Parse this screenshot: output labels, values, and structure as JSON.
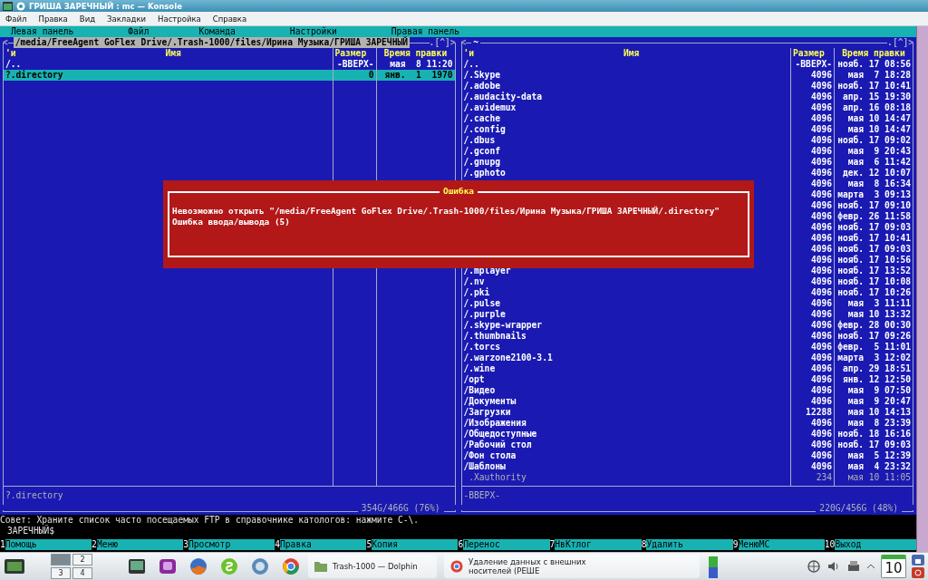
{
  "window": {
    "title": "ГРИША ЗАРЕЧНЫЙ : mc — Konsole"
  },
  "menu_bar": [
    "Файл",
    "Правка",
    "Вид",
    "Закладки",
    "Настройка",
    "Справка"
  ],
  "mc_menu": [
    "Левая панель",
    "Файл",
    "Команда",
    "Настройки",
    "Правая панель"
  ],
  "left_panel": {
    "active": true,
    "corner_left": "<",
    "path": "/media/FreeAgent GoFlex Drive/.Trash-1000/files/Ирина Музыка/ГРИША ЗАРЕЧНЫЙ",
    "corner_right": ".[^]>",
    "sort_mark": "'и",
    "columns": [
      "Имя",
      "Размер",
      "Время правки"
    ],
    "rows": [
      {
        "name": "/..",
        "size": "-ВВЕРХ-",
        "time": "мая  8 11:20",
        "kind": "dir",
        "selected": false
      },
      {
        "name": "?.directory",
        "size": "0",
        "time": "янв.  1  1970",
        "kind": "dir",
        "selected": true
      }
    ],
    "status": "?.directory",
    "disk": "354G/466G (76%)"
  },
  "right_panel": {
    "active": false,
    "corner_left": "<",
    "path": "~",
    "corner_right": ".[^]>",
    "sort_mark": "'и",
    "columns": [
      "Имя",
      "Размер",
      "Время правки"
    ],
    "rows": [
      {
        "name": "/..",
        "size": "-ВВЕРХ-",
        "time": "нояб. 17 08:56",
        "kind": "dir",
        "selected": false
      },
      {
        "name": "/.Skype",
        "size": "4096",
        "time": "мая  7 18:28",
        "kind": "dir",
        "selected": false
      },
      {
        "name": "/.adobe",
        "size": "4096",
        "time": "нояб. 17 10:41",
        "kind": "dir",
        "selected": false
      },
      {
        "name": "/.audacity-data",
        "size": "4096",
        "time": "апр. 15 19:30",
        "kind": "dir",
        "selected": false
      },
      {
        "name": "/.avidemux",
        "size": "4096",
        "time": "апр. 16 08:18",
        "kind": "dir",
        "selected": false
      },
      {
        "name": "/.cache",
        "size": "4096",
        "time": "мая 10 14:47",
        "kind": "dir",
        "selected": false
      },
      {
        "name": "/.config",
        "size": "4096",
        "time": "мая 10 14:47",
        "kind": "dir",
        "selected": false
      },
      {
        "name": "/.dbus",
        "size": "4096",
        "time": "нояб. 17 09:02",
        "kind": "dir",
        "selected": false
      },
      {
        "name": "/.gconf",
        "size": "4096",
        "time": "мая  9 20:43",
        "kind": "dir",
        "selected": false
      },
      {
        "name": "/.gnupg",
        "size": "4096",
        "time": "мая  6 11:42",
        "kind": "dir",
        "selected": false
      },
      {
        "name": "/.gphoto",
        "size": "4096",
        "time": "дек. 12 10:07",
        "kind": "dir",
        "selected": false
      },
      {
        "size": "4096",
        "time": "мая  8 16:34",
        "kind": "dir",
        "selected": false
      },
      {
        "size": "4096",
        "time": "марта  3 09:13",
        "kind": "dir",
        "selected": false
      },
      {
        "size": "4096",
        "time": "нояб. 17 09:10",
        "kind": "dir",
        "selected": false
      },
      {
        "size": "4096",
        "time": "февр. 26 11:58",
        "kind": "dir",
        "selected": false
      },
      {
        "size": "4096",
        "time": "нояб. 17 09:03",
        "kind": "dir",
        "selected": false
      },
      {
        "size": "4096",
        "time": "нояб. 17 10:41",
        "kind": "dir",
        "selected": false
      },
      {
        "size": "4096",
        "time": "нояб. 17 09:03",
        "kind": "dir",
        "selected": false
      },
      {
        "size": "4096",
        "time": "нояб. 17 10:56",
        "kind": "dir",
        "selected": false
      },
      {
        "name": "/.mplayer",
        "size": "4096",
        "time": "нояб. 17 13:52",
        "kind": "dir",
        "selected": false
      },
      {
        "name": "/.nv",
        "size": "4096",
        "time": "нояб. 17 10:08",
        "kind": "dir",
        "selected": false
      },
      {
        "name": "/.pki",
        "size": "4096",
        "time": "нояб. 17 10:26",
        "kind": "dir",
        "selected": false
      },
      {
        "name": "/.pulse",
        "size": "4096",
        "time": "мая  3 11:11",
        "kind": "dir",
        "selected": false
      },
      {
        "name": "/.purple",
        "size": "4096",
        "time": "мая 10 13:32",
        "kind": "dir",
        "selected": false
      },
      {
        "name": "/.skype-wrapper",
        "size": "4096",
        "time": "февр. 28 00:30",
        "kind": "dir",
        "selected": false
      },
      {
        "name": "/.thumbnails",
        "size": "4096",
        "time": "нояб. 17 09:26",
        "kind": "dir",
        "selected": false
      },
      {
        "name": "/.torcs",
        "size": "4096",
        "time": "февр.  5 11:01",
        "kind": "dir",
        "selected": false
      },
      {
        "name": "/.warzone2100-3.1",
        "size": "4096",
        "time": "марта  3 12:02",
        "kind": "dir",
        "selected": false
      },
      {
        "name": "/.wine",
        "size": "4096",
        "time": "апр. 29 18:51",
        "kind": "dir",
        "selected": false
      },
      {
        "name": "/opt",
        "size": "4096",
        "time": "янв. 12 12:50",
        "kind": "dir",
        "selected": false
      },
      {
        "name": "/Видео",
        "size": "4096",
        "time": "мая  9 07:50",
        "kind": "dir",
        "selected": false
      },
      {
        "name": "/Документы",
        "size": "4096",
        "time": "мая  9 20:47",
        "kind": "dir",
        "selected": false
      },
      {
        "name": "/Загрузки",
        "size": "12288",
        "time": "мая 10 14:13",
        "kind": "dir",
        "selected": false
      },
      {
        "name": "/Изображения",
        "size": "4096",
        "time": "мая  8 23:39",
        "kind": "dir",
        "selected": false
      },
      {
        "name": "/Общедоступные",
        "size": "4096",
        "time": "нояб. 18 16:16",
        "kind": "dir",
        "selected": false
      },
      {
        "name": "/Рабочий стол",
        "size": "4096",
        "time": "нояб. 17 09:03",
        "kind": "dir",
        "selected": false
      },
      {
        "name": "/Фон стола",
        "size": "4096",
        "time": "мая  5 12:39",
        "kind": "dir",
        "selected": false
      },
      {
        "name": "/Шаблоны",
        "size": "4096",
        "time": "мая  4 23:32",
        "kind": "dir",
        "selected": false
      },
      {
        "name": ".Xauthority",
        "size": "234",
        "time": "мая 10 11:05",
        "kind": "file",
        "selected": false
      }
    ],
    "status": "-ВВЕРХ-",
    "disk": "220G/456G (48%)"
  },
  "dialog": {
    "title": "Ошибка",
    "lines": [
      "Невозможно открыть \"/media/FreeAgent GoFlex Drive/.Trash-1000/files/Ирина Музыка/ГРИША ЗАРЕЧНЫЙ/.directory\"",
      "Ошибка ввода/вывода (5)"
    ]
  },
  "hint": "Совет: Храните список часто посещаемых FTP в справочнике катологов: нажмите C-\\.",
  "prompt": "ЗАРЕЧНЫЙ$",
  "function_keys": [
    {
      "number": "1",
      "label": "Помощь"
    },
    {
      "number": "2",
      "label": "Меню"
    },
    {
      "number": "3",
      "label": "Просмотр"
    },
    {
      "number": "4",
      "label": "Правка"
    },
    {
      "number": "5",
      "label": "Копия"
    },
    {
      "number": "6",
      "label": "Перенос"
    },
    {
      "number": "7",
      "label": "НвКтлог"
    },
    {
      "number": "8",
      "label": "Удалить"
    },
    {
      "number": "9",
      "label": "МенюМС"
    },
    {
      "number": "10",
      "label": "Выход"
    }
  ],
  "taskbar": {
    "desktops": [
      {
        "selected": true
      },
      {
        "label": "2",
        "selected": false
      },
      {
        "label": "3",
        "selected": false
      },
      {
        "label": "4",
        "selected": false
      }
    ],
    "tasks": [
      {
        "kind": "folder",
        "title": "Trash-1000 — Dolphin"
      },
      {
        "kind": "browser",
        "title": "Удаление данных с внешних носителей (РЕШЕ"
      }
    ],
    "calendar_day": "10"
  }
}
